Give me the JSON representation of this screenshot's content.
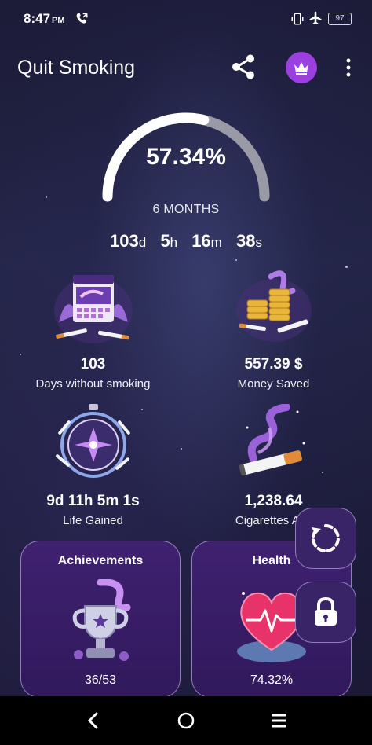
{
  "status_bar": {
    "time": "8:47",
    "ampm": "PM",
    "battery": "97"
  },
  "app_bar": {
    "title": "Quit Smoking"
  },
  "progress": {
    "percent_text": "57.34%",
    "fraction": 0.5734,
    "label": "6 MONTHS",
    "timer": {
      "days": "103",
      "days_unit": "d",
      "hours": "5",
      "hours_unit": "h",
      "minutes": "16",
      "minutes_unit": "m",
      "seconds": "38",
      "seconds_unit": "s"
    }
  },
  "stats": [
    {
      "value": "103",
      "label": "Days without smoking",
      "icon": "calendar-cigarettes-icon"
    },
    {
      "value": "557.39 $",
      "label": "Money Saved",
      "icon": "coins-stack-icon"
    },
    {
      "value": "9d 11h 5m 1s",
      "label": "Life Gained",
      "icon": "stopwatch-icon"
    },
    {
      "value": "1,238.64",
      "label": "Cigarettes Avo",
      "icon": "cigarette-smoke-icon"
    }
  ],
  "cards": {
    "achievements": {
      "title": "Achievements",
      "value": "36/53"
    },
    "health": {
      "title": "Health",
      "value": "74.32%"
    }
  },
  "colors": {
    "accent": "#9b3fe0",
    "card_bg": "#3a1f68",
    "gauge_track": "#9a9aa6",
    "gauge_fill": "#ffffff"
  }
}
